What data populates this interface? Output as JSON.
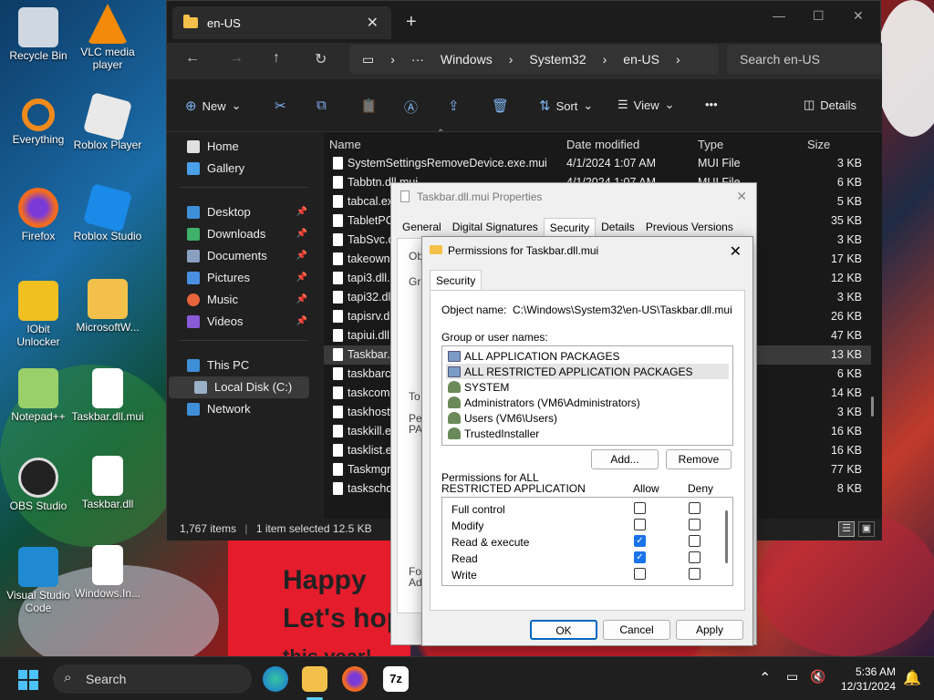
{
  "desktop": {
    "icons": [
      {
        "label": "Recycle Bin",
        "icon": "recycle-bin-icon"
      },
      {
        "label": "VLC media player",
        "icon": "vlc-icon"
      },
      {
        "label": "Everything",
        "icon": "everything-search-icon"
      },
      {
        "label": "Roblox Player",
        "icon": "roblox-player-icon"
      },
      {
        "label": "Firefox",
        "icon": "firefox-icon"
      },
      {
        "label": "Roblox Studio",
        "icon": "roblox-studio-icon"
      },
      {
        "label": "IObit Unlocker",
        "icon": "iobit-unlocker-icon"
      },
      {
        "label": "MicrosoftW...",
        "icon": "folder-icon"
      },
      {
        "label": "Notepad++",
        "icon": "notepadpp-icon"
      },
      {
        "label": "Taskbar.dll.mui",
        "icon": "file-icon"
      },
      {
        "label": "OBS Studio",
        "icon": "obs-icon"
      },
      {
        "label": "Taskbar.dll",
        "icon": "dll-file-icon"
      },
      {
        "label": "Visual Studio Code",
        "icon": "vscode-icon"
      },
      {
        "label": "Windows.In...",
        "icon": "dll-file-icon"
      }
    ],
    "wallpaper_text": [
      "Happy",
      "Let's hop",
      "this year!"
    ]
  },
  "explorer": {
    "tab_title": "en-US",
    "new_tab": "+",
    "breadcrumb": [
      "Windows",
      "System32",
      "en-US"
    ],
    "search_placeholder": "Search en-US",
    "commands": {
      "new": "New",
      "sort": "Sort",
      "view": "View",
      "more": "•••",
      "details": "Details"
    },
    "nav": [
      {
        "label": "Home",
        "pinned": false
      },
      {
        "label": "Gallery",
        "pinned": false
      },
      {
        "label": "Desktop",
        "pinned": true
      },
      {
        "label": "Downloads",
        "pinned": true
      },
      {
        "label": "Documents",
        "pinned": true
      },
      {
        "label": "Pictures",
        "pinned": true
      },
      {
        "label": "Music",
        "pinned": true
      },
      {
        "label": "Videos",
        "pinned": true
      },
      {
        "label": "This PC",
        "pinned": false
      },
      {
        "label": "Local Disk (C:)",
        "pinned": false
      },
      {
        "label": "Network",
        "pinned": false
      }
    ],
    "columns": {
      "name": "Name",
      "date": "Date modified",
      "type": "Type",
      "size": "Size"
    },
    "files": [
      {
        "name": "SystemSettingsRemoveDevice.exe.mui",
        "date": "4/1/2024 1:07 AM",
        "type": "MUI File",
        "size": "3 KB"
      },
      {
        "name": "Tabbtn.dll.mui",
        "date": "4/1/2024 1:07 AM",
        "type": "MUI File",
        "size": "6 KB"
      },
      {
        "name": "tabcal.ex",
        "date": "",
        "type": "",
        "size": "5 KB"
      },
      {
        "name": "TabletPC",
        "date": "",
        "type": "",
        "size": "35 KB"
      },
      {
        "name": "TabSvc.d",
        "date": "",
        "type": "",
        "size": "3 KB"
      },
      {
        "name": "takeown.",
        "date": "",
        "type": "",
        "size": "17 KB"
      },
      {
        "name": "tapi3.dll.",
        "date": "",
        "type": "",
        "size": "12 KB"
      },
      {
        "name": "tapi32.dll",
        "date": "",
        "type": "",
        "size": "3 KB"
      },
      {
        "name": "tapisrv.dl",
        "date": "",
        "type": "",
        "size": "26 KB"
      },
      {
        "name": "tapiui.dll",
        "date": "",
        "type": "",
        "size": "47 KB"
      },
      {
        "name": "Taskbar.c",
        "date": "",
        "type": "",
        "size": "13 KB"
      },
      {
        "name": "taskbarcp",
        "date": "",
        "type": "",
        "size": "6 KB"
      },
      {
        "name": "taskcomp",
        "date": "",
        "type": "",
        "size": "14 KB"
      },
      {
        "name": "taskhostw",
        "date": "",
        "type": "",
        "size": "3 KB"
      },
      {
        "name": "taskkill.ex",
        "date": "",
        "type": "",
        "size": "16 KB"
      },
      {
        "name": "tasklist.ex",
        "date": "",
        "type": "",
        "size": "16 KB"
      },
      {
        "name": "Taskmgr.",
        "date": "",
        "type": "",
        "size": "77 KB"
      },
      {
        "name": "taskschd.",
        "date": "",
        "type": "",
        "size": "8 KB"
      }
    ],
    "status": {
      "count": "1,767 items",
      "selected": "1 item selected  12.5 KB"
    }
  },
  "properties": {
    "title": "Taskbar.dll.mui Properties",
    "tabs": [
      "General",
      "Digital Signatures",
      "Security",
      "Details",
      "Previous Versions"
    ],
    "fragments": [
      "Ob",
      "Gr",
      "To",
      "Pe",
      "PA",
      "Fo",
      "Ad"
    ]
  },
  "permissions": {
    "title": "Permissions for Taskbar.dll.mui",
    "tab": "Security",
    "object_label": "Object name:",
    "object_value": "C:\\Windows\\System32\\en-US\\Taskbar.dll.mui",
    "group_label": "Group or user names:",
    "groups": [
      {
        "name": "ALL APPLICATION PACKAGES",
        "selected": false,
        "kind": "group"
      },
      {
        "name": "ALL RESTRICTED APPLICATION PACKAGES",
        "selected": true,
        "kind": "group"
      },
      {
        "name": "SYSTEM",
        "selected": false,
        "kind": "user"
      },
      {
        "name": "Administrators (VM6\\Administrators)",
        "selected": false,
        "kind": "user"
      },
      {
        "name": "Users (VM6\\Users)",
        "selected": false,
        "kind": "user"
      },
      {
        "name": "TrustedInstaller",
        "selected": false,
        "kind": "user"
      }
    ],
    "add_button": "Add...",
    "remove_button": "Remove",
    "perm_label_line1": "Permissions for ALL",
    "perm_label_line2": "RESTRICTED APPLICATION",
    "allow_header": "Allow",
    "deny_header": "Deny",
    "perms": [
      {
        "name": "Full control",
        "allow": false,
        "deny": false
      },
      {
        "name": "Modify",
        "allow": false,
        "deny": false
      },
      {
        "name": "Read & execute",
        "allow": true,
        "deny": false
      },
      {
        "name": "Read",
        "allow": true,
        "deny": false
      },
      {
        "name": "Write",
        "allow": false,
        "deny": false
      }
    ],
    "ok": "OK",
    "cancel": "Cancel",
    "apply": "Apply"
  },
  "taskbar": {
    "search": "Search",
    "time": "5:36 AM",
    "date": "12/31/2024"
  }
}
